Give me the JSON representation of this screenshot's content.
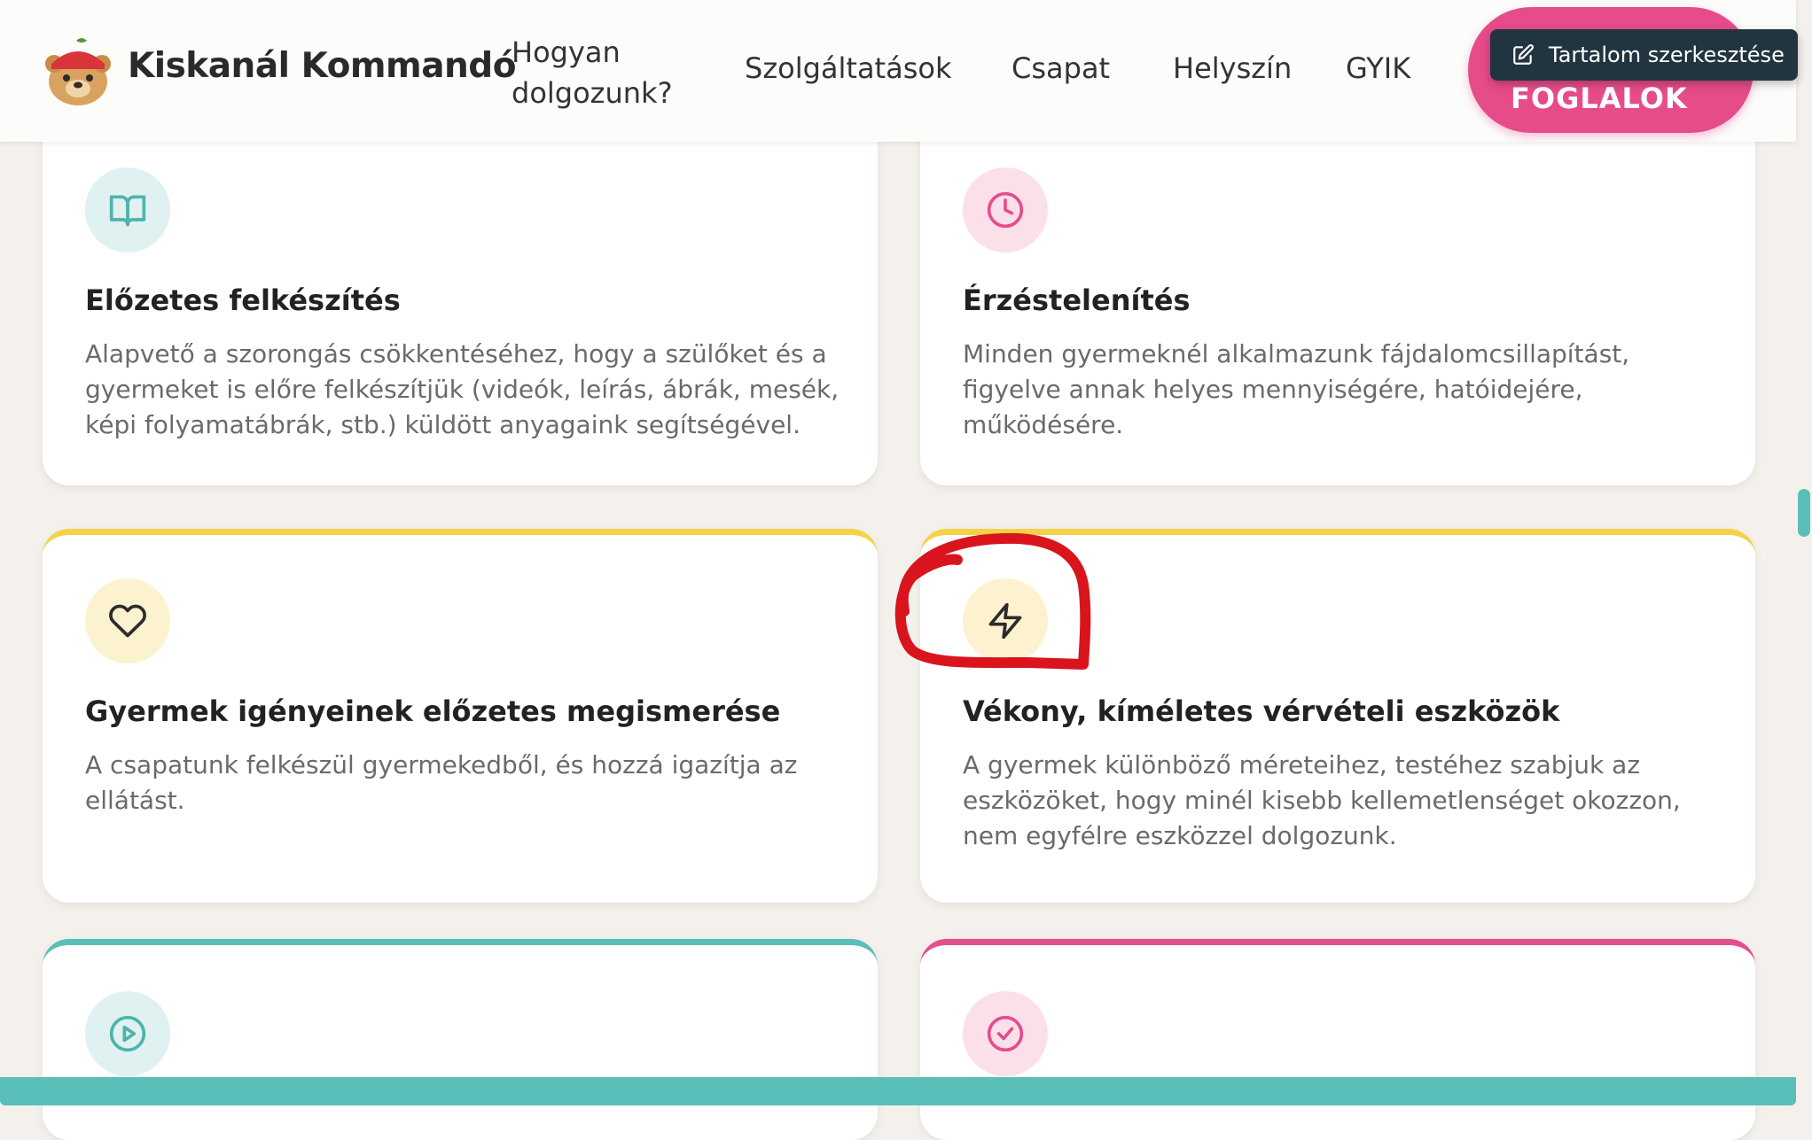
{
  "header": {
    "brand": "Kiskanál Kommandó",
    "nav": {
      "how_line1": "Hogyan",
      "how_line2": "dolgozunk?",
      "services": "Szolgáltatások",
      "team": "Csapat",
      "location": "Helyszín",
      "faq": "GYIK"
    },
    "book_label": "FOGLALOK",
    "edit_label": "Tartalom szerkesztése"
  },
  "cards": [
    {
      "icon": "book-open-icon",
      "title": "Előzetes felkészítés",
      "text": "Alapvető a szorongás csökkentéséhez, hogy a szülőket és a gyermeket is előre felkészítjük (videók, leírás, ábrák, mesék, képi folyamatábrák, stb.) küldött anyagaink segítségével."
    },
    {
      "icon": "clock-icon",
      "title": "Érzéstelenítés",
      "text": "Minden gyermeknél alkalmazunk fájdalomcsillapítást, figyelve annak helyes mennyiségére, hatóidejére, működésére."
    },
    {
      "icon": "heart-icon",
      "title": "Gyermek igényeinek előzetes megismerése",
      "text": "A csapatunk felkészül gyermekedből, és hozzá igazítja az ellátást."
    },
    {
      "icon": "lightning-icon",
      "title": "Vékony, kíméletes vérvételi eszközök",
      "text": "A gyermek különböző méreteihez, testéhez szabjuk az eszközöket, hogy minél kisebb kellemetlenséget okozzon, nem egyfélre eszközzel dolgozunk."
    },
    {
      "icon": "play-circle-icon"
    },
    {
      "icon": "check-circle-icon"
    }
  ],
  "colors": {
    "brand_pink": "#e64b8a",
    "teal": "#5bbfb9",
    "yellow": "#f4d247",
    "annotation_red": "#d9141d",
    "page_bg": "#f4f1ec"
  }
}
